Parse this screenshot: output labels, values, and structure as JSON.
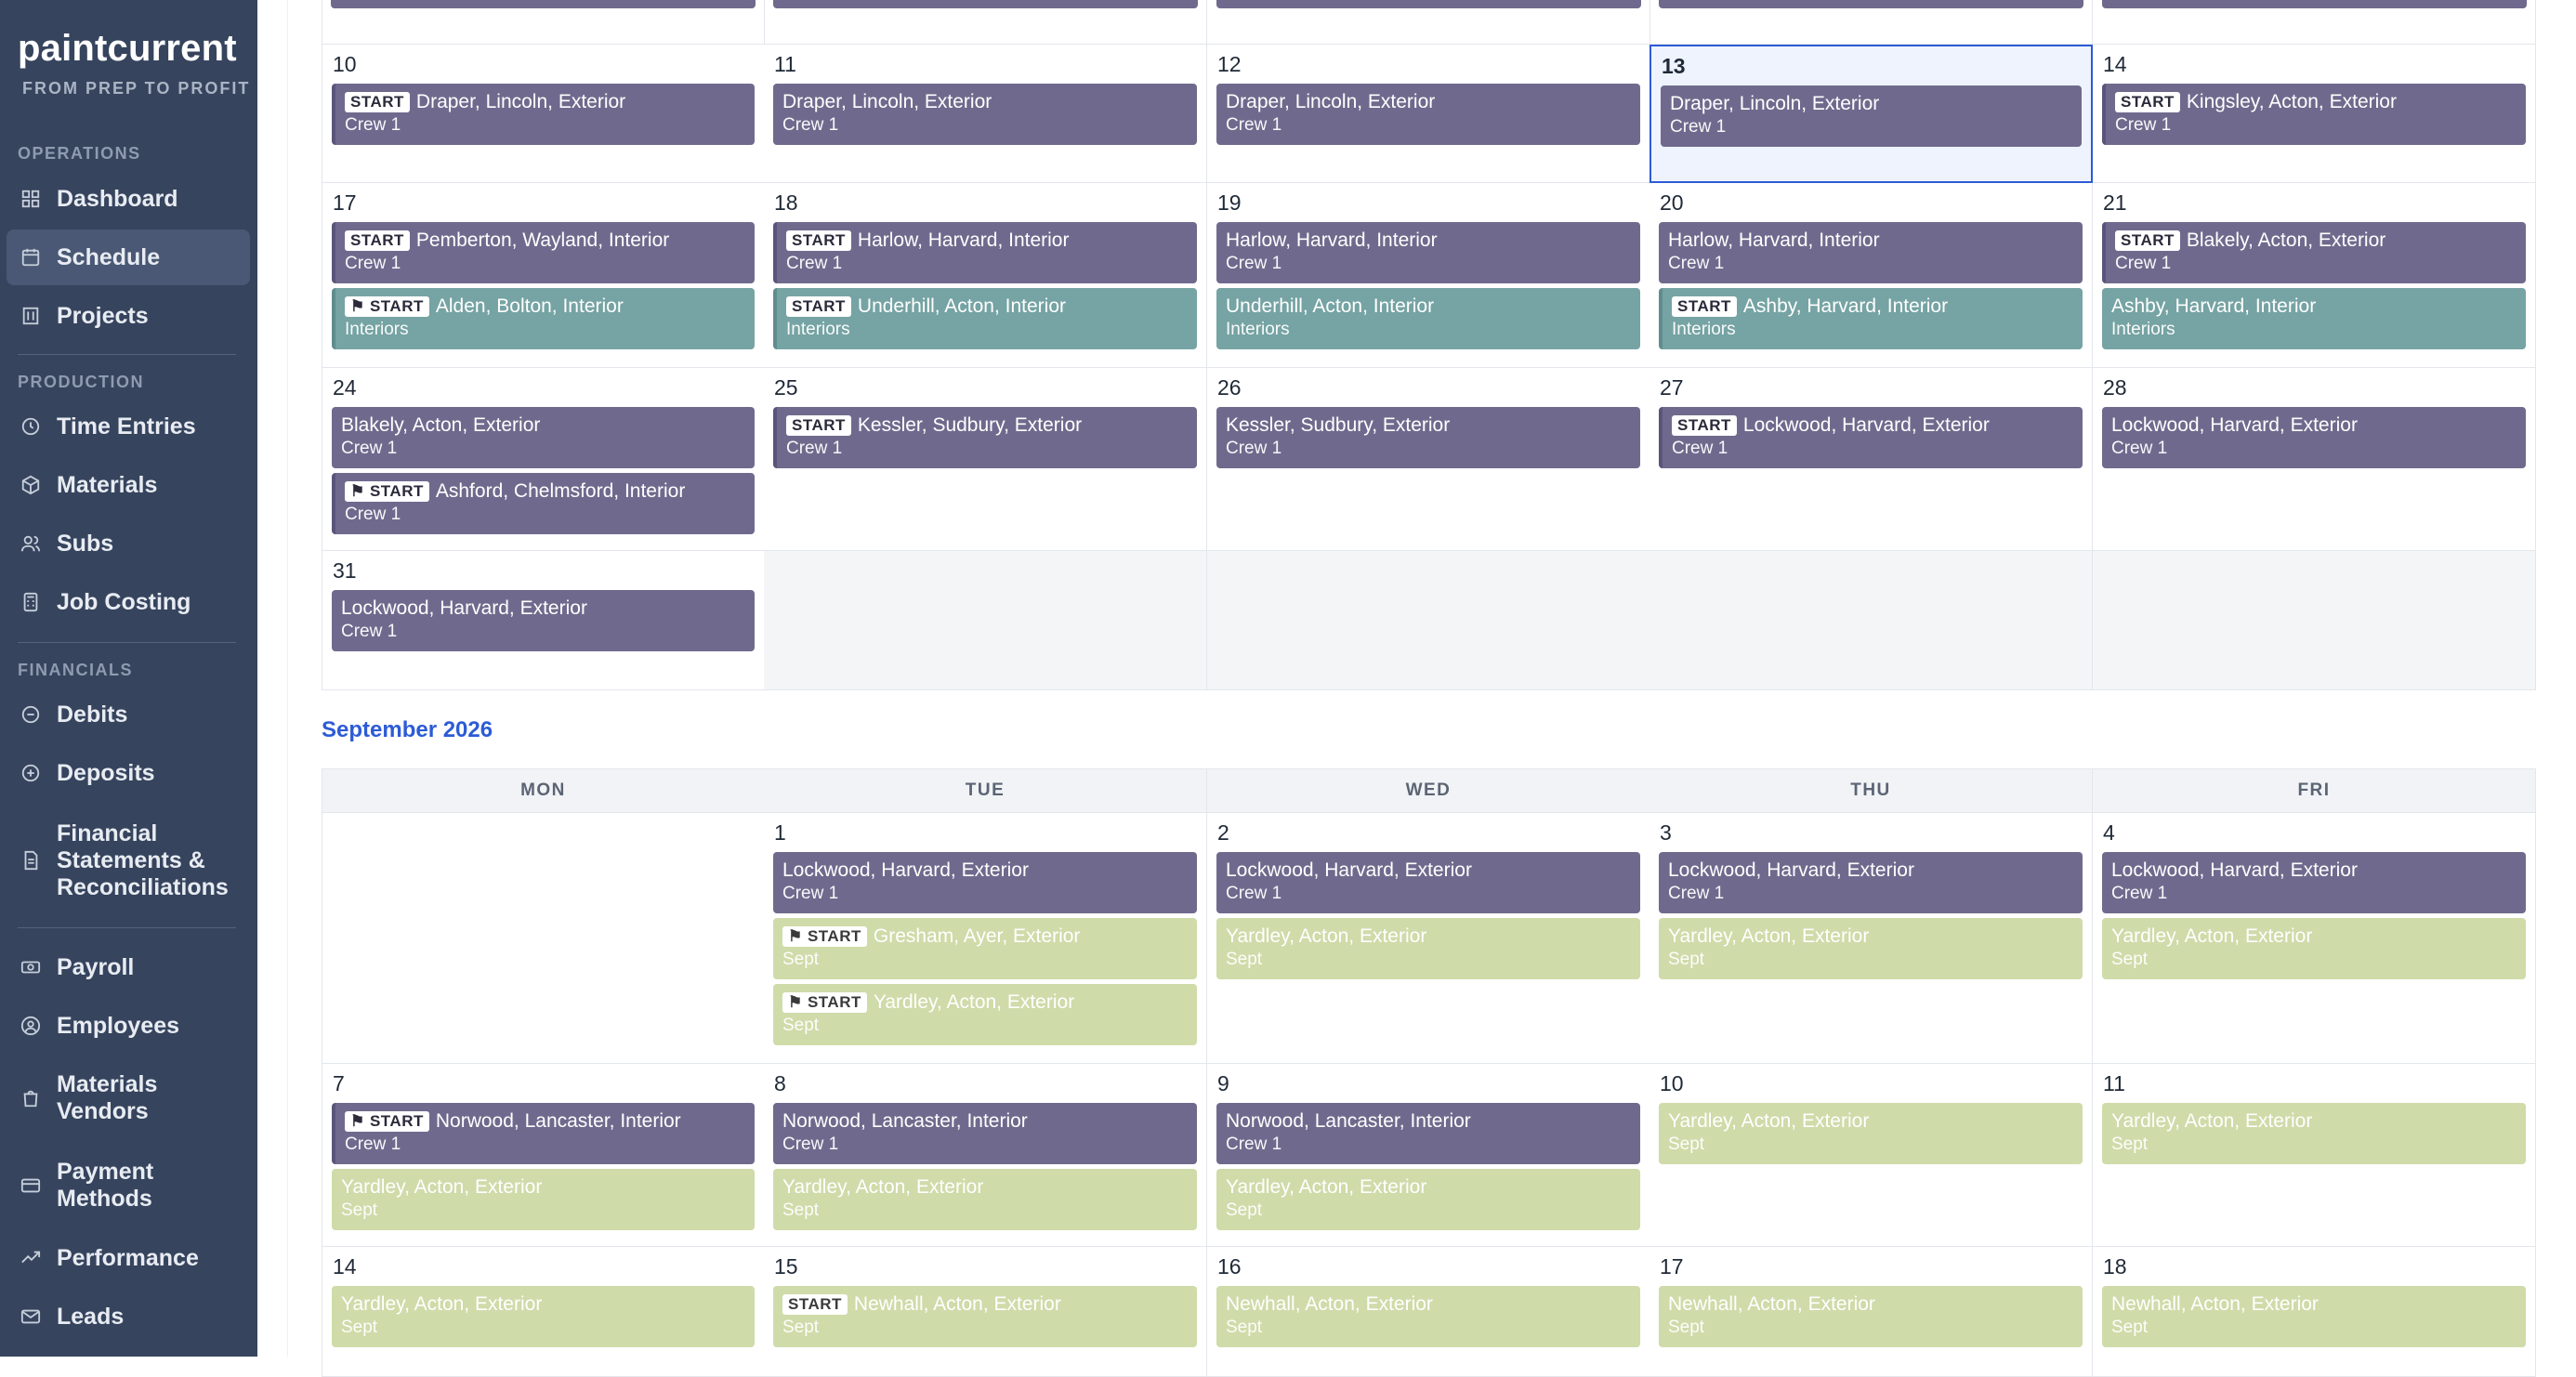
{
  "sidebar": {
    "brand": "paintcurrent",
    "tagline": "FROM PREP TO PROFIT",
    "sections": {
      "operations": "OPERATIONS",
      "production": "PRODUCTION",
      "financials": "FINANCIALS"
    },
    "items": {
      "dashboard": {
        "label": "Dashboard",
        "icon": "grid-icon"
      },
      "schedule": {
        "label": "Schedule",
        "icon": "calendar-icon",
        "active": true
      },
      "projects": {
        "label": "Projects",
        "icon": "building-icon"
      },
      "time_entries": {
        "label": "Time Entries",
        "icon": "clock-icon"
      },
      "materials": {
        "label": "Materials",
        "icon": "box-icon"
      },
      "subs": {
        "label": "Subs",
        "icon": "users-icon"
      },
      "job_costing": {
        "label": "Job Costing",
        "icon": "calculator-icon"
      },
      "debits": {
        "label": "Debits",
        "icon": "minus-circle-icon"
      },
      "deposits": {
        "label": "Deposits",
        "icon": "plus-circle-icon"
      },
      "financial_statements": {
        "label": "Financial Statements & Reconciliations",
        "icon": "document-icon"
      },
      "payroll": {
        "label": "Payroll",
        "icon": "money-icon"
      },
      "employees": {
        "label": "Employees",
        "icon": "user-circle-icon"
      },
      "materials_vendors": {
        "label": "Materials Vendors",
        "icon": "shopping-bag-icon"
      },
      "payment_methods": {
        "label": "Payment Methods",
        "icon": "credit-card-icon"
      },
      "performance": {
        "label": "Performance",
        "icon": "trend-icon"
      },
      "leads": {
        "label": "Leads",
        "icon": "mail-icon"
      }
    }
  },
  "colors": {
    "exterior": "#6f6a8d",
    "interior": "#76a3a3",
    "sept": "#cfdba9",
    "accent": "#2d5bd6",
    "sidebar": "#36445e"
  },
  "badges": {
    "start": "START",
    "flag_start": "⚑ START"
  },
  "august": {
    "weeks": [
      {
        "days": [
          {
            "day": "10",
            "events": [
              {
                "title": "Draper, Lincoln, Exterior",
                "sub": "Crew 1",
                "kind": "ext",
                "start": "START"
              }
            ]
          },
          {
            "day": "11",
            "events": [
              {
                "title": "Draper, Lincoln, Exterior",
                "sub": "Crew 1",
                "kind": "ext"
              }
            ]
          },
          {
            "day": "12",
            "events": [
              {
                "title": "Draper, Lincoln, Exterior",
                "sub": "Crew 1",
                "kind": "ext"
              }
            ]
          },
          {
            "day": "13",
            "today": true,
            "events": [
              {
                "title": "Draper, Lincoln, Exterior",
                "sub": "Crew 1",
                "kind": "ext"
              }
            ]
          },
          {
            "day": "14",
            "events": [
              {
                "title": "Kingsley, Acton, Exterior",
                "sub": "Crew 1",
                "kind": "ext",
                "start": "START"
              }
            ]
          }
        ]
      },
      {
        "days": [
          {
            "day": "17",
            "events": [
              {
                "title": "Pemberton, Wayland, Interior",
                "sub": "Crew 1",
                "kind": "ext",
                "start": "START"
              },
              {
                "title": "Alden, Bolton, Interior",
                "sub": "Interiors",
                "kind": "int",
                "start": "⚑ START"
              }
            ]
          },
          {
            "day": "18",
            "events": [
              {
                "title": "Harlow, Harvard, Interior",
                "sub": "Crew 1",
                "kind": "ext",
                "start": "START"
              },
              {
                "title": "Underhill, Acton, Interior",
                "sub": "Interiors",
                "kind": "int",
                "start": "START"
              }
            ]
          },
          {
            "day": "19",
            "events": [
              {
                "title": "Harlow, Harvard, Interior",
                "sub": "Crew 1",
                "kind": "ext"
              },
              {
                "title": "Underhill, Acton, Interior",
                "sub": "Interiors",
                "kind": "int"
              }
            ]
          },
          {
            "day": "20",
            "events": [
              {
                "title": "Harlow, Harvard, Interior",
                "sub": "Crew 1",
                "kind": "ext"
              },
              {
                "title": "Ashby, Harvard, Interior",
                "sub": "Interiors",
                "kind": "int",
                "start": "START"
              }
            ]
          },
          {
            "day": "21",
            "events": [
              {
                "title": "Blakely, Acton, Exterior",
                "sub": "Crew 1",
                "kind": "ext",
                "start": "START"
              },
              {
                "title": "Ashby, Harvard, Interior",
                "sub": "Interiors",
                "kind": "int"
              }
            ]
          }
        ]
      },
      {
        "days": [
          {
            "day": "24",
            "events": [
              {
                "title": "Blakely, Acton, Exterior",
                "sub": "Crew 1",
                "kind": "ext"
              },
              {
                "title": "Ashford, Chelmsford, Interior",
                "sub": "Crew 1",
                "kind": "ext",
                "start": "⚑ START"
              }
            ]
          },
          {
            "day": "25",
            "events": [
              {
                "title": "Kessler, Sudbury, Exterior",
                "sub": "Crew 1",
                "kind": "ext",
                "start": "START"
              }
            ]
          },
          {
            "day": "26",
            "events": [
              {
                "title": "Kessler, Sudbury, Exterior",
                "sub": "Crew 1",
                "kind": "ext"
              }
            ]
          },
          {
            "day": "27",
            "events": [
              {
                "title": "Lockwood, Harvard, Exterior",
                "sub": "Crew 1",
                "kind": "ext",
                "start": "START"
              }
            ]
          },
          {
            "day": "28",
            "events": [
              {
                "title": "Lockwood, Harvard, Exterior",
                "sub": "Crew 1",
                "kind": "ext"
              }
            ]
          }
        ]
      },
      {
        "days": [
          {
            "day": "31",
            "events": [
              {
                "title": "Lockwood, Harvard, Exterior",
                "sub": "Crew 1",
                "kind": "ext"
              }
            ]
          },
          {
            "day": "",
            "empty": true,
            "events": []
          },
          {
            "day": "",
            "empty": true,
            "events": []
          },
          {
            "day": "",
            "empty": true,
            "events": []
          },
          {
            "day": "",
            "empty": true,
            "events": []
          }
        ]
      }
    ]
  },
  "september": {
    "title": "September 2026",
    "weekdays": [
      "MON",
      "TUE",
      "WED",
      "THU",
      "FRI"
    ],
    "weeks": [
      {
        "days": [
          {
            "day": "",
            "events": []
          },
          {
            "day": "1",
            "events": [
              {
                "title": "Lockwood, Harvard, Exterior",
                "sub": "Crew 1",
                "kind": "ext"
              },
              {
                "title": "Gresham, Ayer, Exterior",
                "sub": "Sept",
                "kind": "sept",
                "start": "⚑ START"
              },
              {
                "title": "Yardley, Acton, Exterior",
                "sub": "Sept",
                "kind": "sept",
                "start": "⚑ START"
              }
            ]
          },
          {
            "day": "2",
            "events": [
              {
                "title": "Lockwood, Harvard, Exterior",
                "sub": "Crew 1",
                "kind": "ext"
              },
              {
                "title": "Yardley, Acton, Exterior",
                "sub": "Sept",
                "kind": "sept"
              }
            ]
          },
          {
            "day": "3",
            "events": [
              {
                "title": "Lockwood, Harvard, Exterior",
                "sub": "Crew 1",
                "kind": "ext"
              },
              {
                "title": "Yardley, Acton, Exterior",
                "sub": "Sept",
                "kind": "sept"
              }
            ]
          },
          {
            "day": "4",
            "events": [
              {
                "title": "Lockwood, Harvard, Exterior",
                "sub": "Crew 1",
                "kind": "ext"
              },
              {
                "title": "Yardley, Acton, Exterior",
                "sub": "Sept",
                "kind": "sept"
              }
            ]
          }
        ]
      },
      {
        "days": [
          {
            "day": "7",
            "events": [
              {
                "title": "Norwood, Lancaster, Interior",
                "sub": "Crew 1",
                "kind": "ext",
                "start": "⚑ START"
              },
              {
                "title": "Yardley, Acton, Exterior",
                "sub": "Sept",
                "kind": "sept"
              }
            ]
          },
          {
            "day": "8",
            "events": [
              {
                "title": "Norwood, Lancaster, Interior",
                "sub": "Crew 1",
                "kind": "ext"
              },
              {
                "title": "Yardley, Acton, Exterior",
                "sub": "Sept",
                "kind": "sept"
              }
            ]
          },
          {
            "day": "9",
            "events": [
              {
                "title": "Norwood, Lancaster, Interior",
                "sub": "Crew 1",
                "kind": "ext"
              },
              {
                "title": "Yardley, Acton, Exterior",
                "sub": "Sept",
                "kind": "sept"
              }
            ]
          },
          {
            "day": "10",
            "events": [
              {
                "title": "Yardley, Acton, Exterior",
                "sub": "Sept",
                "kind": "sept"
              }
            ]
          },
          {
            "day": "11",
            "events": [
              {
                "title": "Yardley, Acton, Exterior",
                "sub": "Sept",
                "kind": "sept"
              }
            ]
          }
        ]
      },
      {
        "days": [
          {
            "day": "14",
            "events": [
              {
                "title": "Yardley, Acton, Exterior",
                "sub": "Sept",
                "kind": "sept"
              }
            ]
          },
          {
            "day": "15",
            "events": [
              {
                "title": "Newhall, Acton, Exterior",
                "sub": "Sept",
                "kind": "sept",
                "start": "START"
              }
            ]
          },
          {
            "day": "16",
            "events": [
              {
                "title": "Newhall, Acton, Exterior",
                "sub": "Sept",
                "kind": "sept"
              }
            ]
          },
          {
            "day": "17",
            "events": [
              {
                "title": "Newhall, Acton, Exterior",
                "sub": "Sept",
                "kind": "sept"
              }
            ]
          },
          {
            "day": "18",
            "events": [
              {
                "title": "Newhall, Acton, Exterior",
                "sub": "Sept",
                "kind": "sept"
              }
            ]
          }
        ]
      }
    ]
  }
}
